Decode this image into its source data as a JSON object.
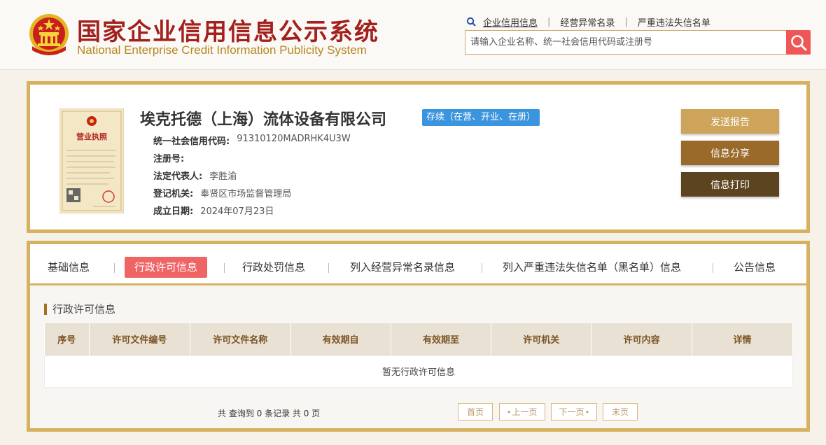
{
  "header": {
    "title_cn": "国家企业信用信息公示系统",
    "title_en": "National Enterprise Credit Information Publicity System",
    "links": [
      "企业信用信息",
      "经营异常名录",
      "严重违法失信名单"
    ],
    "search_placeholder": "请输入企业名称、统一社会信用代码或注册号"
  },
  "license_image": {
    "title": "营业执照"
  },
  "company": {
    "name": "埃克托德（上海）流体设备有限公司",
    "status": "存续（在营、开业、在册）",
    "fields": [
      {
        "label": "统一社会信用代码:",
        "value": "91310120MADRHK4U3W"
      },
      {
        "label": "注册号:",
        "value": ""
      },
      {
        "label": "法定代表人:",
        "value": "李胜渝"
      },
      {
        "label": "登记机关:",
        "value": "奉贤区市场监督管理局"
      },
      {
        "label": "成立日期:",
        "value": "2024年07月23日"
      }
    ],
    "actions": [
      {
        "label": "发送报告",
        "color": "#cea35a"
      },
      {
        "label": "信息分享",
        "color": "#9a6a2a"
      },
      {
        "label": "信息打印",
        "color": "#5d4420"
      }
    ]
  },
  "tabs": [
    "基础信息",
    "行政许可信息",
    "行政处罚信息",
    "列入经营异常名录信息",
    "列入严重违法失信名单（黑名单）信息",
    "公告信息"
  ],
  "active_tab": "行政许可信息",
  "section": {
    "title": "行政许可信息",
    "columns": [
      "序号",
      "许可文件编号",
      "许可文件名称",
      "有效期自",
      "有效期至",
      "许可机关",
      "许可内容",
      "详情"
    ],
    "empty_text": "暂无行政许可信息"
  },
  "pager": {
    "summary": "共 查询到 0 条记录 共 0 页",
    "first": "首页",
    "prev": "上一页",
    "next": "下一页",
    "last": "末页"
  },
  "colors": {
    "brand_red": "#a3201c",
    "gold_border": "#d6b260",
    "search_red": "#ef5756",
    "status_blue": "#3b94de",
    "active_tab": "#ef6465"
  }
}
